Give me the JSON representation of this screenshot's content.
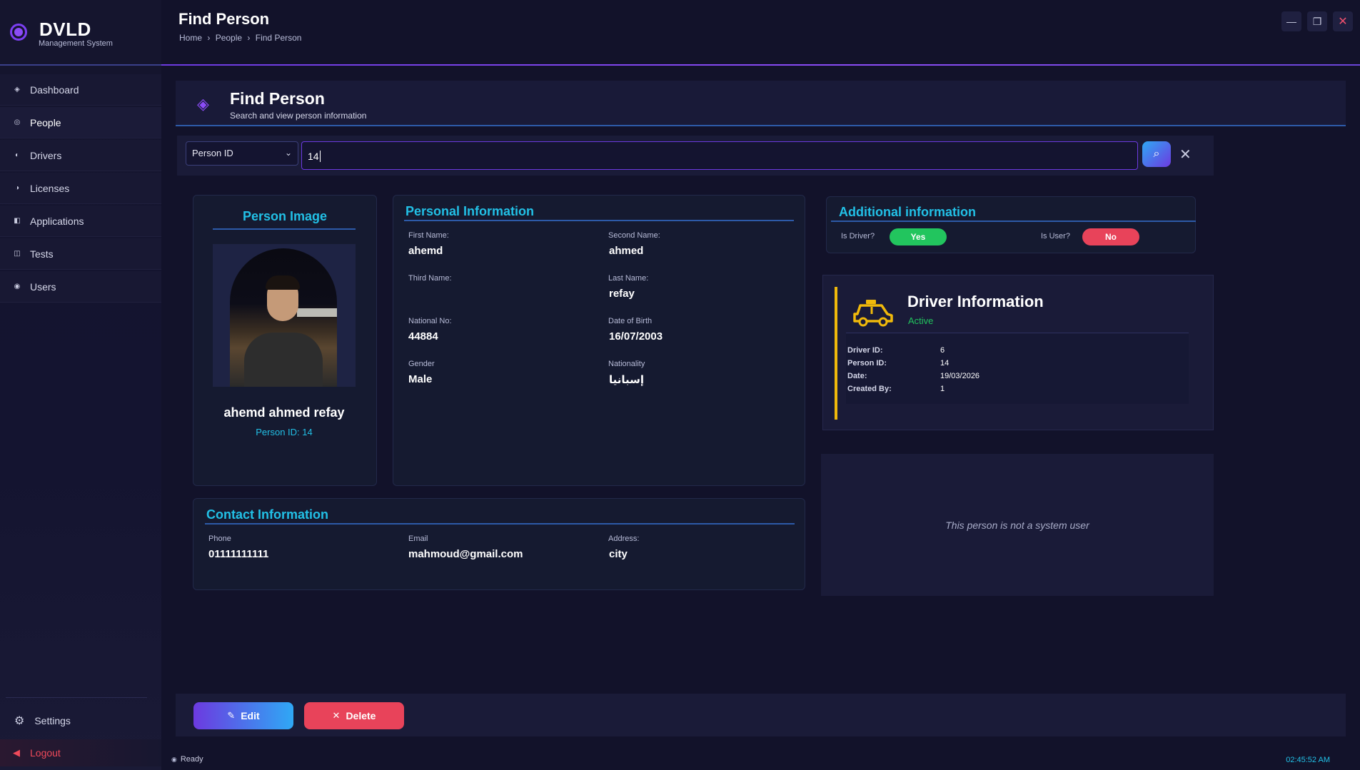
{
  "brand": {
    "title": "DVLD",
    "subtitle": "Management System"
  },
  "sidebar": {
    "items": [
      {
        "label": "Dashboard",
        "icon": "diamond-icon"
      },
      {
        "label": "People",
        "icon": "people-icon"
      },
      {
        "label": "Drivers",
        "icon": "drivers-icon"
      },
      {
        "label": "Licenses",
        "icon": "licenses-icon"
      },
      {
        "label": "Applications",
        "icon": "applications-icon"
      },
      {
        "label": "Tests",
        "icon": "tests-icon"
      },
      {
        "label": "Users",
        "icon": "users-icon"
      }
    ],
    "active": "People",
    "settings_label": "Settings",
    "logout_label": "Logout"
  },
  "header": {
    "title": "Find Person",
    "breadcrumb": [
      "Home",
      "People",
      "Find Person"
    ],
    "separator": "›"
  },
  "banner": {
    "title": "Find Person",
    "subtitle": "Search and view person information"
  },
  "search": {
    "filter_value": "Person ID",
    "query": "14"
  },
  "person_card": {
    "title": "Person Image",
    "full_name": "ahemd ahmed refay",
    "person_id_text": "Person ID: 14"
  },
  "personal_info": {
    "title": "Personal Information",
    "fields": {
      "first_name_label": "First Name:",
      "first_name": "ahemd",
      "second_name_label": "Second Name:",
      "second_name": "ahmed",
      "third_name_label": "Third Name:",
      "third_name": "",
      "last_name_label": "Last Name:",
      "last_name": "refay",
      "national_no_label": "National No:",
      "national_no": "44884",
      "dob_label": "Date of Birth",
      "dob": "16/07/2003",
      "gender_label": "Gender",
      "gender": "Male",
      "nationality_label": "Nationality",
      "nationality": "إسبانيا"
    }
  },
  "contact_info": {
    "title": "Contact Information",
    "phone_label": "Phone",
    "phone": "01111111111",
    "email_label": "Email",
    "email": "mahmoud@gmail.com",
    "address_label": "Address:",
    "address": "city"
  },
  "additional_info": {
    "title": "Additional information",
    "is_driver_label": "Is Driver?",
    "is_driver": "Yes",
    "is_user_label": "Is User?",
    "is_user": "No"
  },
  "driver_info": {
    "title": "Driver Information",
    "status": "Active",
    "rows": [
      {
        "key": "Driver ID:",
        "value": "6"
      },
      {
        "key": "Person ID:",
        "value": "14"
      },
      {
        "key": "Date:",
        "value": "19/03/2026"
      },
      {
        "key": "Created By:",
        "value": "1"
      }
    ]
  },
  "user_info": {
    "message": "This person is not a system user"
  },
  "actions": {
    "edit_label": "Edit",
    "delete_label": "Delete"
  },
  "status": {
    "text": "Ready",
    "time": "02:45:52 AM"
  },
  "colors": {
    "accent_purple": "#8b4cf6",
    "accent_cyan": "#22c0e6",
    "yes_green": "#22c55e",
    "no_red": "#e8435a",
    "driver_yellow": "#f0b90b"
  }
}
